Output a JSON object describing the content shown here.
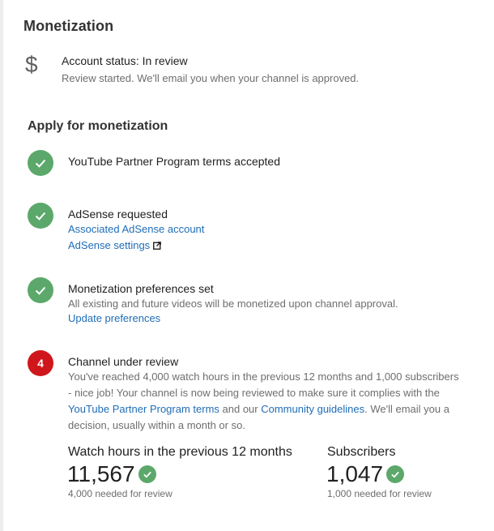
{
  "page": {
    "title": "Monetization"
  },
  "account": {
    "icon": "dollar-icon",
    "status_text": "Account status: In review",
    "sub_text": "Review started. We'll email you when your channel is approved."
  },
  "apply": {
    "title": "Apply for monetization",
    "steps": [
      {
        "status": "complete",
        "icon": "checkmark-icon",
        "title": "YouTube Partner Program terms accepted"
      },
      {
        "status": "complete",
        "icon": "checkmark-icon",
        "title": "AdSense requested",
        "links": [
          "Associated AdSense account",
          "AdSense settings"
        ]
      },
      {
        "status": "complete",
        "icon": "checkmark-icon",
        "title": "Monetization preferences set",
        "description": "All existing and future videos will be monetized upon channel approval.",
        "links": [
          "Update preferences"
        ]
      },
      {
        "status": "in-review",
        "number": "4",
        "title": "Channel under review",
        "description_parts": [
          "You've reached 4,000 watch hours in the previous 12 months and 1,000 subscribers - nice job! Your channel is now being reviewed to make sure it complies with the ",
          "YouTube Partner Program terms",
          " and our ",
          "Community guidelines",
          ". We'll email you a decision, usually within a month or so."
        ]
      }
    ]
  },
  "stats": {
    "watch_hours": {
      "label": "Watch hours in the previous 12 months",
      "value": "11,567",
      "note": "4,000 needed for review"
    },
    "subscribers": {
      "label": "Subscribers",
      "value": "1,047",
      "note": "1,000 needed for review"
    }
  },
  "colors": {
    "success": "#5ca86b",
    "alert": "#d0161d",
    "link": "#1f6db7"
  }
}
